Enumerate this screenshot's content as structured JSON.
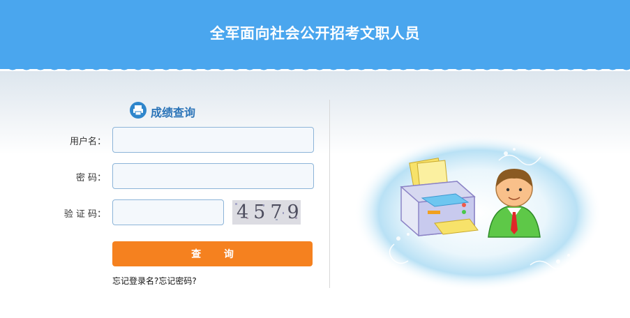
{
  "header": {
    "title": "全军面向社会公开招考文职人员"
  },
  "section": {
    "title": "成绩查询",
    "icon": "printer-icon"
  },
  "form": {
    "username_label": "用户名：",
    "username_value": "",
    "password_label": "密 码：",
    "password_value": "",
    "captcha_label": "验 证 码：",
    "captcha_value": "",
    "captcha_image_text": "4579",
    "submit_label": "查 询"
  },
  "links": {
    "forgot_username": "忘记登录名?",
    "forgot_password": "忘记密码?"
  },
  "colors": {
    "header": "#4aa6ee",
    "accent": "#f5811f",
    "title_text": "#2b74b8"
  }
}
